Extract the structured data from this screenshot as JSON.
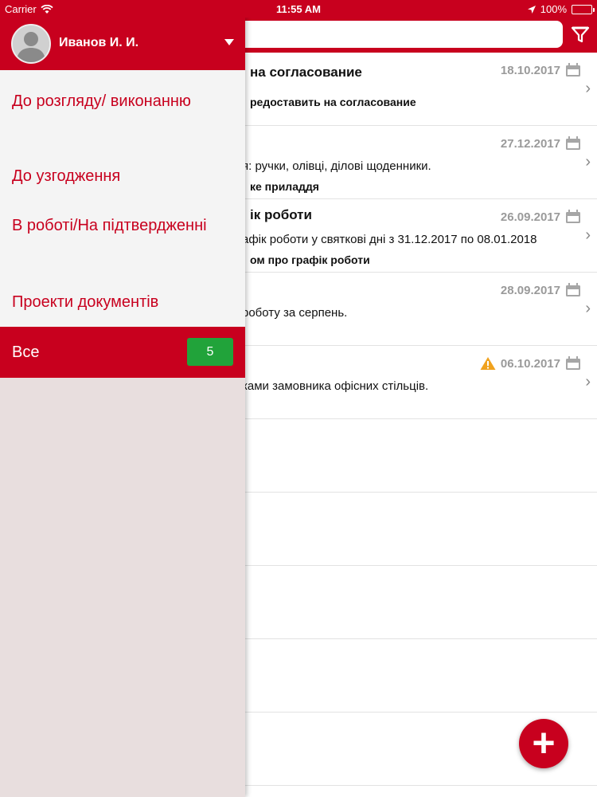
{
  "status_bar": {
    "carrier": "Carrier",
    "time": "11:55 AM",
    "battery": "100%"
  },
  "drawer": {
    "user_name": "Иванов И. И.",
    "menu": [
      {
        "label": "До розгляду/ виконанню"
      },
      {
        "label": "До узгодження"
      },
      {
        "label": "В роботі/На підтвердженні"
      },
      {
        "label": "Проекти документів"
      },
      {
        "label": "Все",
        "badge": "5",
        "active": true
      }
    ]
  },
  "documents": [
    {
      "title": "на согласование",
      "desc": "",
      "extra": "редоставить на согласование",
      "date": "18.10.2017",
      "warning": false
    },
    {
      "title": "",
      "desc": "я: ручки, олівці, ділові щоденники.",
      "extra": "ке приладдя",
      "date": "27.12.2017",
      "warning": false
    },
    {
      "title": "ік роботи",
      "desc": "афік роботи у святкові дні з 31.12.2017 по 08.01.2018",
      "extra": "ом про графік роботи",
      "date": "26.09.2017",
      "warning": false
    },
    {
      "title": "",
      "desc": "роботу за серпень.",
      "extra": "",
      "date": "28.09.2017",
      "warning": false
    },
    {
      "title": "",
      "desc": "ками замовника офісних стільців.",
      "extra": "",
      "date": "06.10.2017",
      "warning": true
    }
  ],
  "colors": {
    "brand": "#c8001e",
    "badge": "#21a33a"
  }
}
